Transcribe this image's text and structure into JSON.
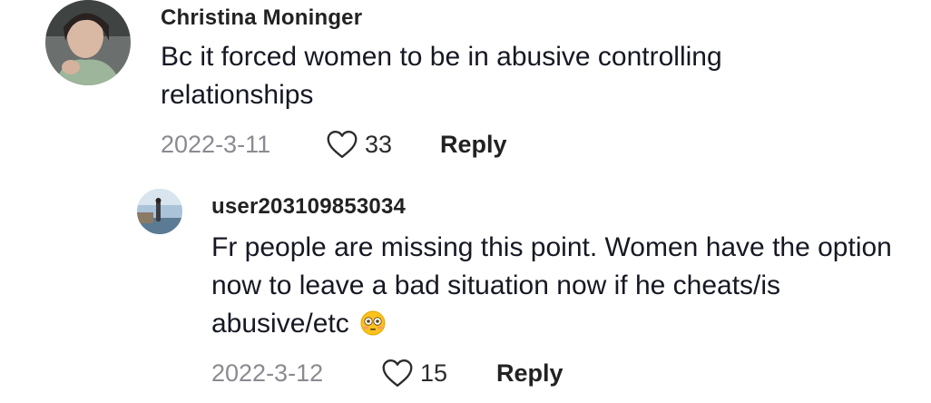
{
  "comments": [
    {
      "username": "Christina Moninger",
      "text": "Bc it forced women to be in abusive controlling relationships",
      "date": "2022-3-11",
      "likes": "33",
      "reply_label": "Reply",
      "avatar_icon": "user-avatar"
    },
    {
      "username": "user203109853034",
      "text": "Fr people are missing this point. Women have the option now to leave a bad situation now if he cheats/is abusive/etc",
      "emoji": "flushed-face-emoji",
      "date": "2022-3-12",
      "likes": "15",
      "reply_label": "Reply",
      "avatar_icon": "user-avatar"
    }
  ]
}
